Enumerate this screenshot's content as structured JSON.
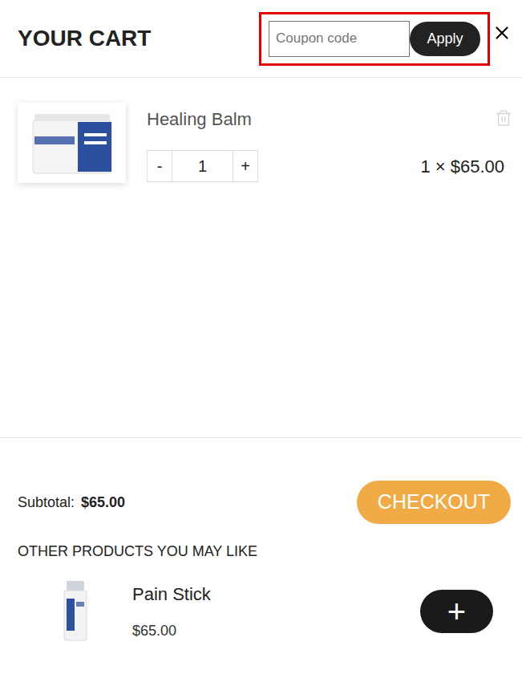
{
  "header": {
    "title": "YOUR CART",
    "coupon": {
      "placeholder": "Coupon code",
      "apply_label": "Apply"
    }
  },
  "items": [
    {
      "name": "Healing Balm",
      "minus": "-",
      "quantity": "1",
      "plus": "+",
      "price_line": "1 × $65.00"
    }
  ],
  "footer": {
    "subtotal_label": "Subtotal:",
    "subtotal_value": "$65.00",
    "checkout_label": "CHECKOUT"
  },
  "recommendations": {
    "title": "OTHER PRODUCTS YOU MAY LIKE",
    "add_label": "+",
    "items": [
      {
        "name": "Pain Stick",
        "price": "$65.00"
      }
    ]
  }
}
